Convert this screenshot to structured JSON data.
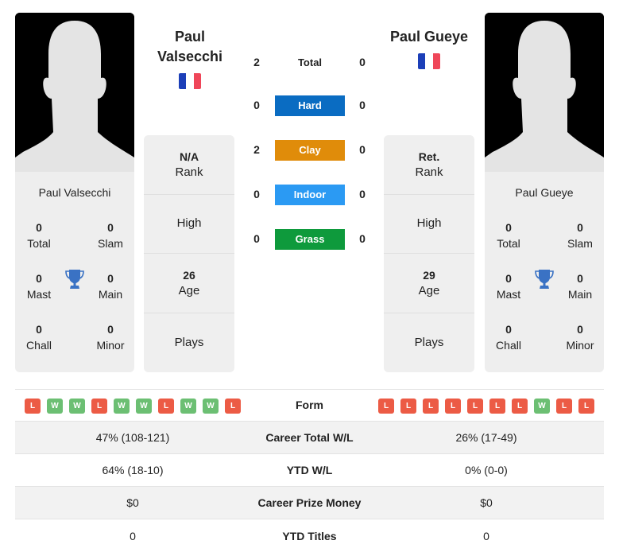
{
  "players": {
    "left": {
      "name_line1": "Paul",
      "name_line2": "Valsecchi",
      "card_name": "Paul Valsecchi",
      "flag_colors": [
        "#1c3fb8",
        "#ffffff",
        "#ef4659"
      ],
      "country": "France",
      "titles": {
        "total": {
          "value": "0",
          "label": "Total"
        },
        "slam": {
          "value": "0",
          "label": "Slam"
        },
        "mast": {
          "value": "0",
          "label": "Mast"
        },
        "main": {
          "value": "0",
          "label": "Main"
        },
        "chall": {
          "value": "0",
          "label": "Chall"
        },
        "minor": {
          "value": "0",
          "label": "Minor"
        }
      },
      "info": {
        "rank_value": "N/A",
        "rank_label": "Rank",
        "high_label": "High",
        "age_value": "26",
        "age_label": "Age",
        "plays_label": "Plays"
      },
      "form": [
        "L",
        "W",
        "W",
        "L",
        "W",
        "W",
        "L",
        "W",
        "W",
        "L"
      ]
    },
    "right": {
      "name_line1": "Paul Gueye",
      "card_name": "Paul Gueye",
      "flag_colors": [
        "#1c3fb8",
        "#ffffff",
        "#ef4659"
      ],
      "country": "France",
      "titles": {
        "total": {
          "value": "0",
          "label": "Total"
        },
        "slam": {
          "value": "0",
          "label": "Slam"
        },
        "mast": {
          "value": "0",
          "label": "Mast"
        },
        "main": {
          "value": "0",
          "label": "Main"
        },
        "chall": {
          "value": "0",
          "label": "Chall"
        },
        "minor": {
          "value": "0",
          "label": "Minor"
        }
      },
      "info": {
        "rank_value": "Ret.",
        "rank_label": "Rank",
        "high_label": "High",
        "age_value": "29",
        "age_label": "Age",
        "plays_label": "Plays"
      },
      "form": [
        "L",
        "L",
        "L",
        "L",
        "L",
        "L",
        "L",
        "W",
        "L",
        "L"
      ]
    }
  },
  "h2h": {
    "total": {
      "label": "Total",
      "left": "2",
      "right": "0"
    },
    "surfaces": [
      {
        "label": "Hard",
        "left": "0",
        "right": "0",
        "color": "#0a6cc2"
      },
      {
        "label": "Clay",
        "left": "2",
        "right": "0",
        "color": "#e08c0a"
      },
      {
        "label": "Indoor",
        "left": "0",
        "right": "0",
        "color": "#2b9af3"
      },
      {
        "label": "Grass",
        "left": "0",
        "right": "0",
        "color": "#0e9a3c"
      }
    ]
  },
  "form_label": "Form",
  "stats": [
    {
      "label": "Career Total W/L",
      "left": "47% (108-121)",
      "right": "26% (17-49)"
    },
    {
      "label": "YTD W/L",
      "left": "64% (18-10)",
      "right": "0% (0-0)"
    },
    {
      "label": "Career Prize Money",
      "left": "$0",
      "right": "$0"
    },
    {
      "label": "YTD Titles",
      "left": "0",
      "right": "0"
    }
  ]
}
